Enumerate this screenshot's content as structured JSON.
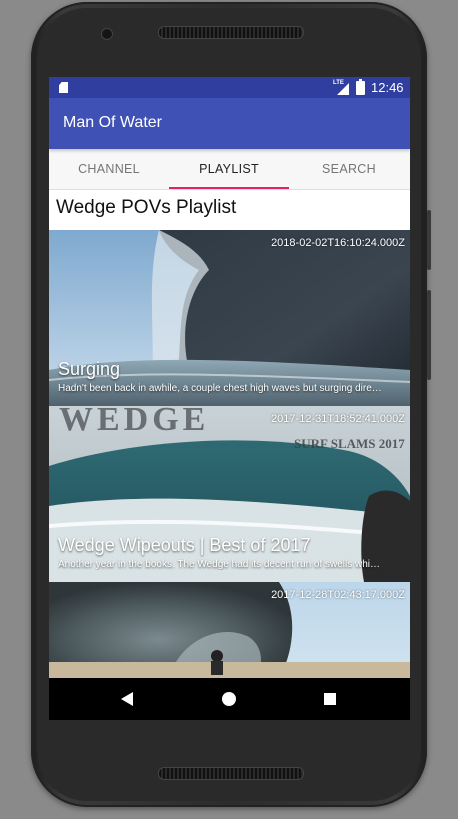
{
  "status_bar": {
    "network": "LTE",
    "time": "12:46"
  },
  "app_bar": {
    "title": "Man Of Water"
  },
  "tabs": [
    {
      "label": "CHANNEL",
      "active": false
    },
    {
      "label": "PLAYLIST",
      "active": true
    },
    {
      "label": "SEARCH",
      "active": false
    }
  ],
  "playlist": {
    "title": "Wedge POVs Playlist",
    "videos": [
      {
        "title": "Surging",
        "published": "2018-02-02T16:10:24.000Z",
        "description": "Hadn't been back in awhile, a couple chest high waves but surging dire…"
      },
      {
        "title": "Wedge Wipeouts | Best of 2017",
        "published": "2017-12-31T18:52:41.000Z",
        "description": "Another year in the books. The Wedge had its decent run of swells whi…",
        "thumb_text": "WEDGE",
        "thumb_subtext": "SURF SLAMS 2017"
      },
      {
        "title": "",
        "published": "2017-12-28T02:43:17.000Z",
        "description": ""
      }
    ]
  },
  "colors": {
    "primary": "#3f51b5",
    "primary_dark": "#303f9f",
    "accent": "#e91e63"
  }
}
